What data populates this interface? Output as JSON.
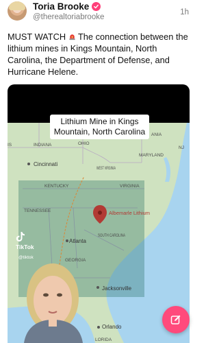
{
  "post": {
    "author_name": "Toria Brooke",
    "handle": "@therealtoriabrooke",
    "time": "1h",
    "text_before_icon": "MUST WATCH",
    "text_after_icon": " The connection between the lithium mines in Kings Mountain, North Carolina, the Department of Defense, and Hurricane Helene."
  },
  "video": {
    "overlay_title": "Lithium Mine in Kings Mountain, North Carolina",
    "tiktok_label": "TikTok",
    "tiktok_user": "@tiktok",
    "map_labels": {
      "illinois": "IS",
      "indiana": "INDIANA",
      "ohio": "OHIO",
      "maryland": "MARYLAND",
      "nj": "NJ",
      "ania": "ANIA",
      "cincinnati": "Cincinnati",
      "west_virginia": "WEST VIRGINIA",
      "kentucky": "KENTUCKY",
      "virginia": "VIRGINIA",
      "tennessee": "TENNESSEE",
      "albemarle": "Albemarle Lithium",
      "atlanta": "Atlanta",
      "south_carolina": "SOUTH CAROLINA",
      "georgia": "GEORGIA",
      "jacksonville": "Jacksonville",
      "orlando": "Orlando",
      "lorida": "LORIDA"
    },
    "colors": {
      "land": "#cfe2c0",
      "water": "#a8d4ef",
      "overlay": "#1f6a5c",
      "pin": "#b23a34"
    }
  },
  "actions": {
    "compose_icon": "compose-icon"
  }
}
